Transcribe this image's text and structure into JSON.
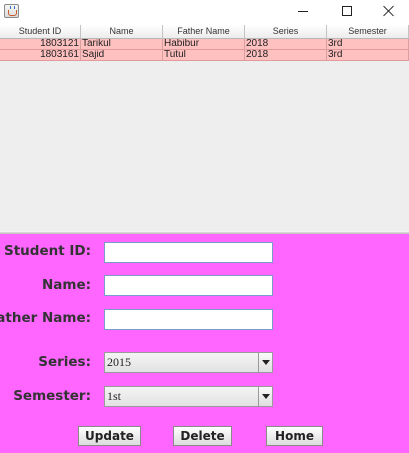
{
  "window": {
    "icons": {
      "app": "java-cup-icon",
      "minimize": "minimize-icon",
      "maximize": "maximize-icon",
      "close": "close-icon"
    }
  },
  "table": {
    "columns": [
      "Student ID",
      "Name",
      "Father Name",
      "Series",
      "Semester"
    ],
    "rows": [
      {
        "student_id": "1803121",
        "name": "Tarikul",
        "father_name": "Habibur",
        "series": "2018",
        "semester": "3rd"
      },
      {
        "student_id": "1803161",
        "name": "Sajid",
        "father_name": "Tutul",
        "series": "2018",
        "semester": "3rd"
      }
    ],
    "row_color": "#ffc0c0"
  },
  "form": {
    "background_color": "#ff66ff",
    "student_id": {
      "label": "Student ID:",
      "value": ""
    },
    "name": {
      "label": "Name:",
      "value": ""
    },
    "father_name": {
      "label": "Father Name:",
      "value": ""
    },
    "series": {
      "label": "Series:",
      "selected": "2015"
    },
    "semester": {
      "label": "Semester:",
      "selected": "1st"
    },
    "buttons": {
      "update": "Update",
      "delete": "Delete",
      "home": "Home"
    }
  }
}
